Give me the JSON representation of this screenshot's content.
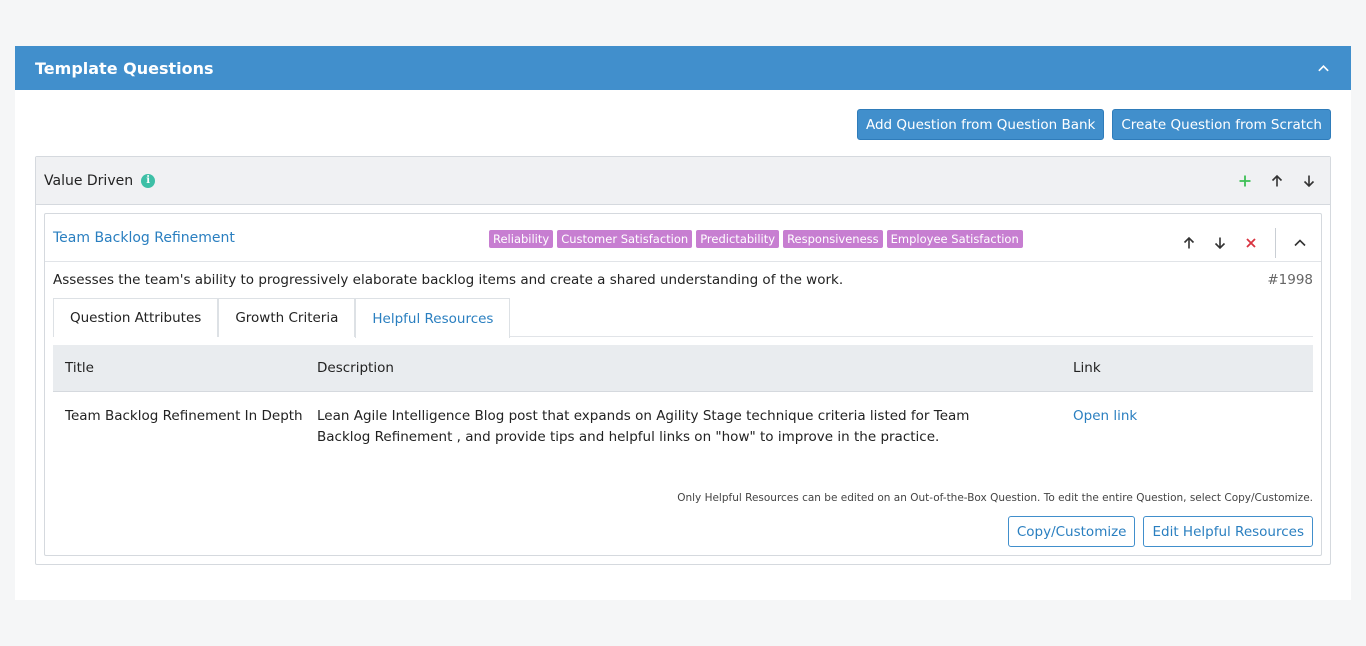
{
  "panel": {
    "title": "Template Questions"
  },
  "toolbar": {
    "add_from_bank": "Add Question from Question Bank",
    "create_from_scratch": "Create Question from Scratch"
  },
  "section": {
    "title": "Value Driven"
  },
  "question": {
    "title": "Team Backlog Refinement",
    "tags": [
      "Reliability",
      "Customer Satisfaction",
      "Predictability",
      "Responsiveness",
      "Employee Satisfaction"
    ],
    "description": "Assesses the team's ability to progressively elaborate backlog items and create a shared understanding of the work.",
    "id": "#1998",
    "tabs": [
      {
        "label": "Question Attributes",
        "active": false
      },
      {
        "label": "Growth Criteria",
        "active": false
      },
      {
        "label": "Helpful Resources",
        "active": true
      }
    ]
  },
  "resources": {
    "columns": [
      "Title",
      "Description",
      "Link"
    ],
    "rows": [
      {
        "title": "Team Backlog Refinement In Depth",
        "description": "Lean Agile Intelligence Blog post that expands on Agility Stage technique criteria listed for Team Backlog Refinement , and provide tips and helpful links on \"how\" to improve in the practice.",
        "link": "Open link"
      }
    ]
  },
  "footer": {
    "note": "Only Helpful Resources can be edited on an Out-of-the-Box Question. To edit the entire Question, select Copy/Customize.",
    "copy_label": "Copy/Customize",
    "edit_label": "Edit Helpful Resources"
  },
  "colors": {
    "header_blue": "#418fcc",
    "tag_purple": "#c77ed1",
    "add_green": "#3dbf55",
    "delete_red": "#d9333f",
    "info_teal": "#3dbfa6"
  },
  "icons": {
    "collapse": "chevron-up-icon",
    "info": "info-icon",
    "add": "plus-icon",
    "move_up": "arrow-up-icon",
    "move_down": "arrow-down-icon",
    "delete": "close-icon"
  }
}
